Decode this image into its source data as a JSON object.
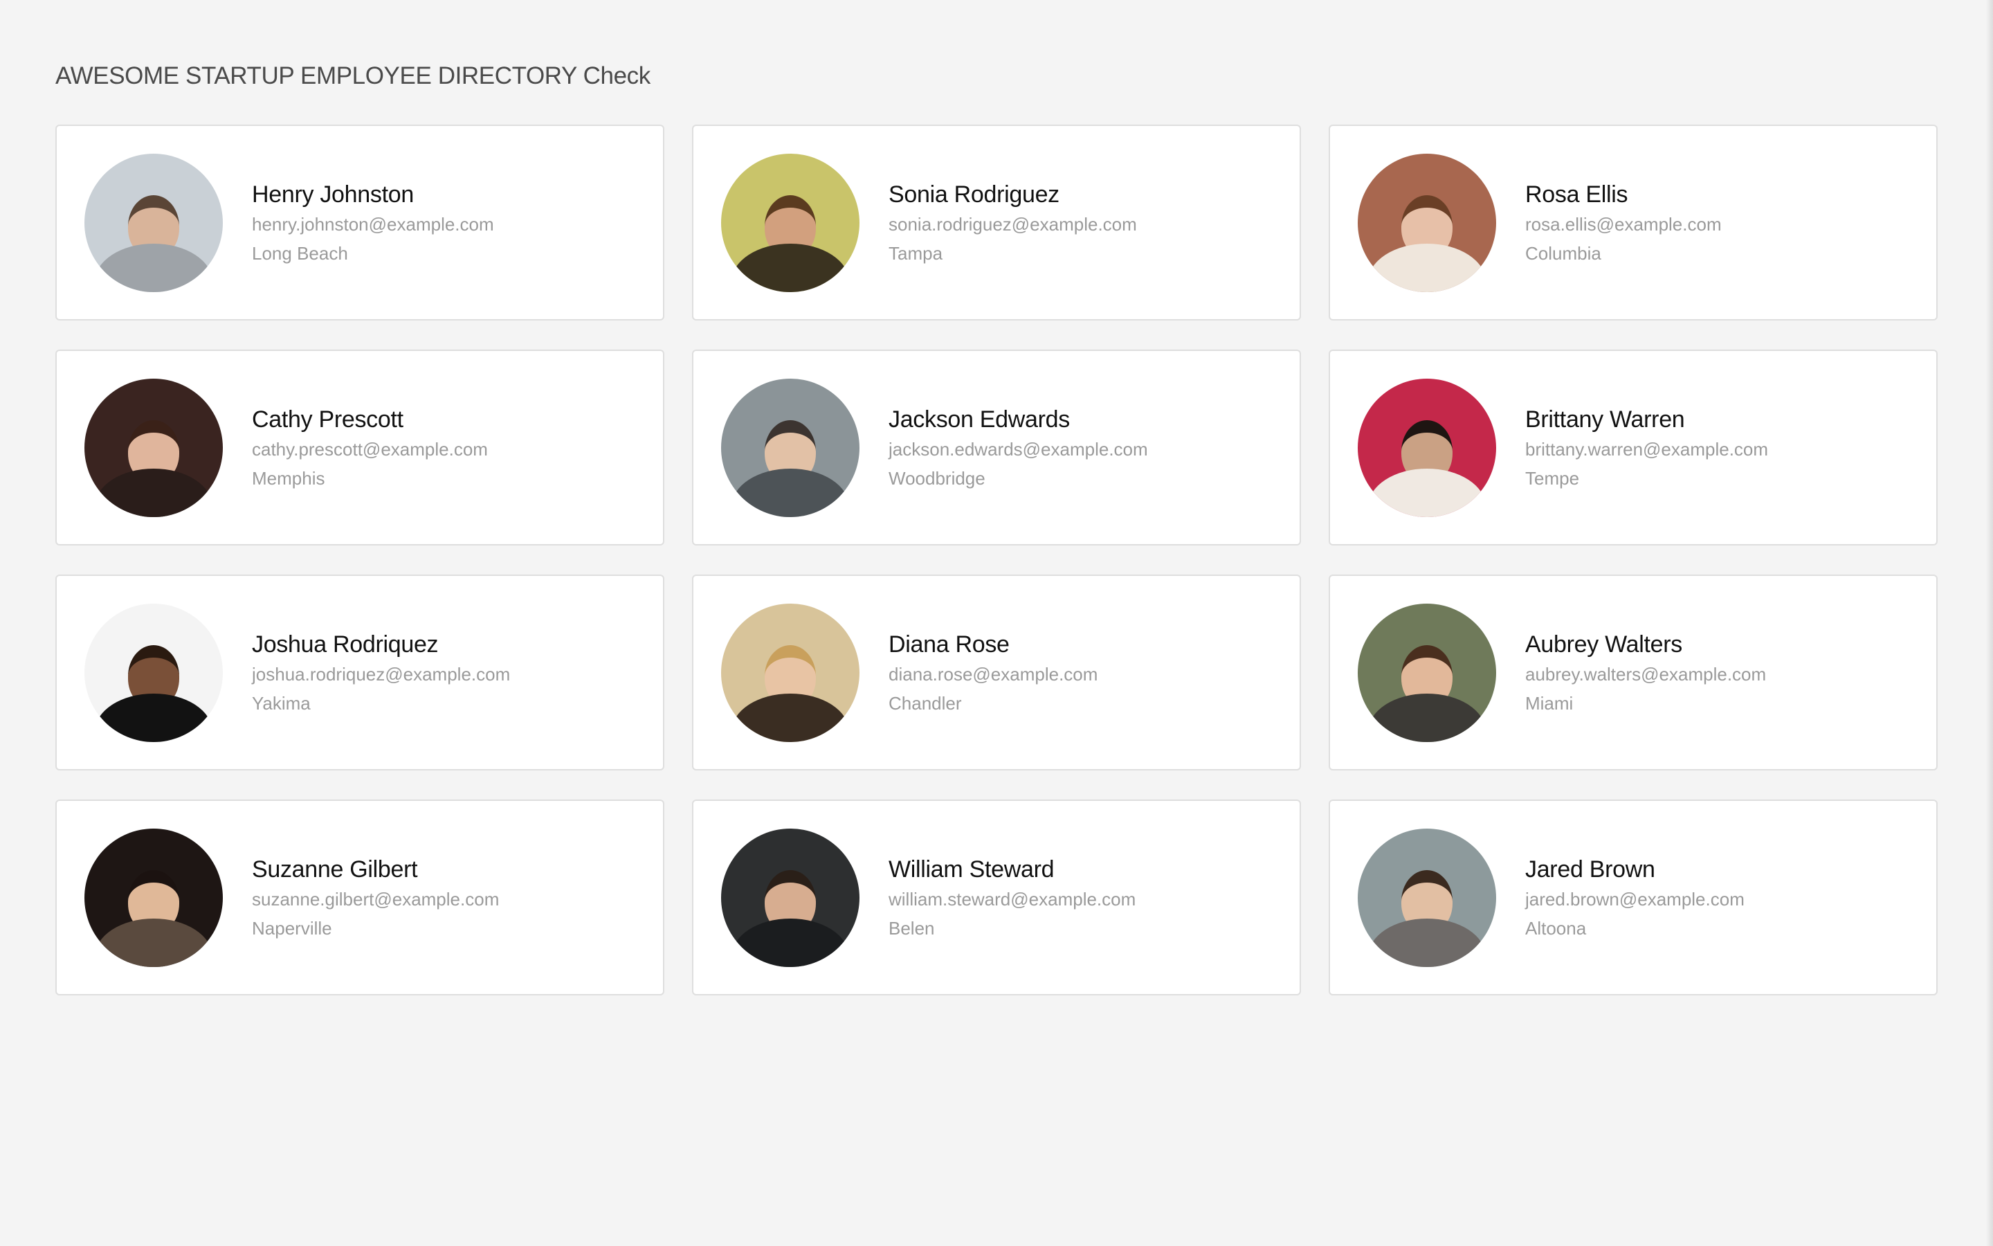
{
  "header": {
    "title": "AWESOME STARTUP EMPLOYEE DIRECTORY Check"
  },
  "employees": [
    {
      "name": "Henry Johnston",
      "email": "henry.johnston@example.com",
      "city": "Long Beach",
      "avatar_bg": "#c9d0d6",
      "skin": "#d9b49a",
      "clothes": "#9ea3a8",
      "hair": "#5a4536"
    },
    {
      "name": "Sonia Rodriguez",
      "email": "sonia.rodriguez@example.com",
      "city": "Tampa",
      "avatar_bg": "#c9c46a",
      "skin": "#d2a07e",
      "clothes": "#3b3320",
      "hair": "#5b3b1f"
    },
    {
      "name": "Rosa Ellis",
      "email": "rosa.ellis@example.com",
      "city": "Columbia",
      "avatar_bg": "#a8674f",
      "skin": "#e7c0a8",
      "clothes": "#efe6dc",
      "hair": "#6a3f26"
    },
    {
      "name": "Cathy Prescott",
      "email": "cathy.prescott@example.com",
      "city": "Memphis",
      "avatar_bg": "#3a2420",
      "skin": "#e0b59c",
      "clothes": "#2a1d1a",
      "hair": "#3a2118"
    },
    {
      "name": "Jackson Edwards",
      "email": "jackson.edwards@example.com",
      "city": "Woodbridge",
      "avatar_bg": "#8b9498",
      "skin": "#e2c1a6",
      "clothes": "#4d5357",
      "hair": "#3c3430"
    },
    {
      "name": "Brittany Warren",
      "email": "brittany.warren@example.com",
      "city": "Tempe",
      "avatar_bg": "#c4284a",
      "skin": "#caa184",
      "clothes": "#f0e9e2",
      "hair": "#1e1512"
    },
    {
      "name": "Joshua Rodriquez",
      "email": "joshua.rodriquez@example.com",
      "city": "Yakima",
      "avatar_bg": "#f4f4f4",
      "skin": "#7a5038",
      "clothes": "#121212",
      "hair": "#2a1a10"
    },
    {
      "name": "Diana Rose",
      "email": "diana.rose@example.com",
      "city": "Chandler",
      "avatar_bg": "#d8c49a",
      "skin": "#e8c4a4",
      "clothes": "#3a2d22",
      "hair": "#c9a05c"
    },
    {
      "name": "Aubrey Walters",
      "email": "aubrey.walters@example.com",
      "city": "Miami",
      "avatar_bg": "#6f7a5a",
      "skin": "#e2b89a",
      "clothes": "#3c3a36",
      "hair": "#4a2f1e"
    },
    {
      "name": "Suzanne Gilbert",
      "email": "suzanne.gilbert@example.com",
      "city": "Naperville",
      "avatar_bg": "#1e1614",
      "skin": "#e0b898",
      "clothes": "#5a4a3e",
      "hair": "#1b1210"
    },
    {
      "name": "William Steward",
      "email": "william.steward@example.com",
      "city": "Belen",
      "avatar_bg": "#2d2f30",
      "skin": "#d7ad90",
      "clothes": "#1b1d1f",
      "hair": "#2a1f18"
    },
    {
      "name": "Jared Brown",
      "email": "jared.brown@example.com",
      "city": "Altoona",
      "avatar_bg": "#8d9a9c",
      "skin": "#e2bfa3",
      "clothes": "#6e6a68",
      "hair": "#3b2a1f"
    }
  ]
}
